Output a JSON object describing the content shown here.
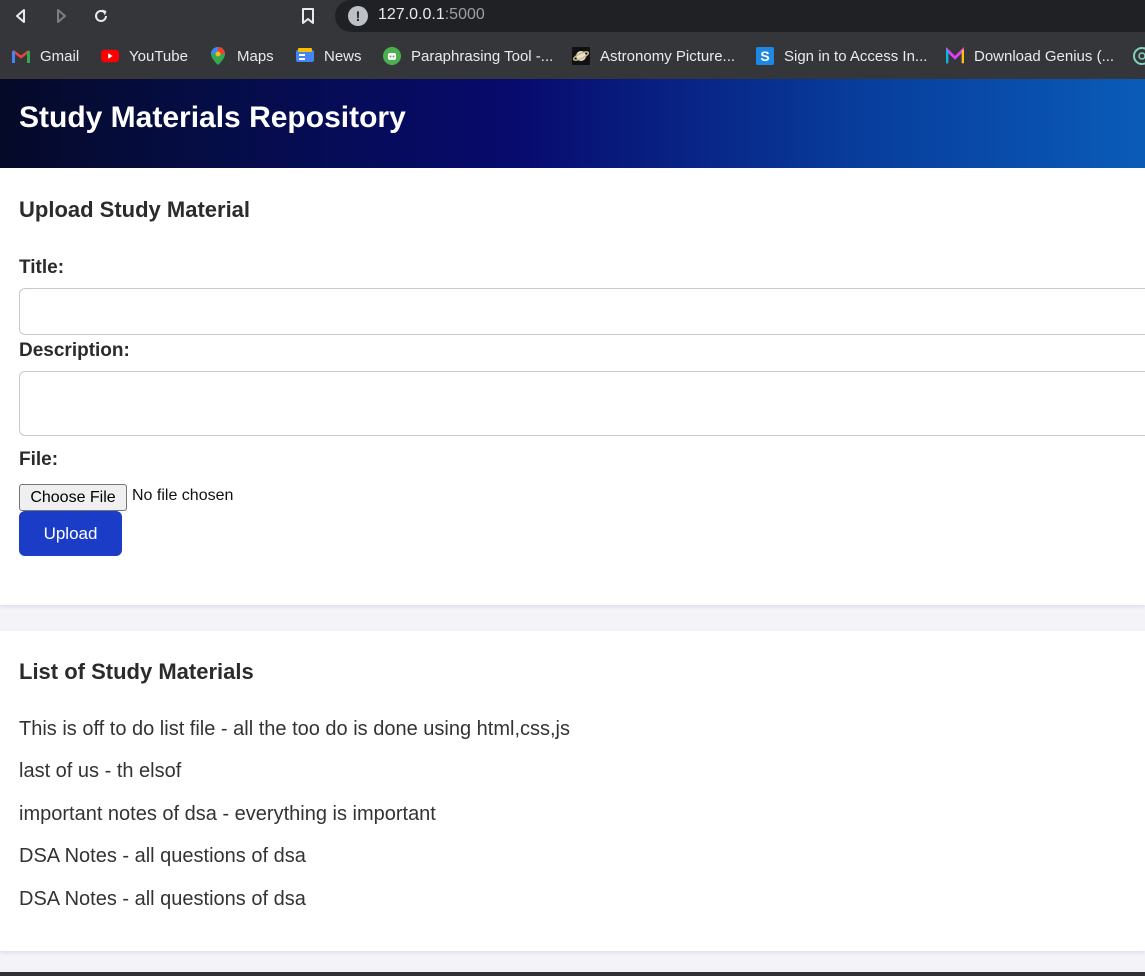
{
  "browser": {
    "url_host": "127.0.0.1",
    "url_port": ":5000",
    "bookmarks": [
      {
        "label": "Gmail",
        "icon": "gmail-icon"
      },
      {
        "label": "YouTube",
        "icon": "youtube-icon"
      },
      {
        "label": "Maps",
        "icon": "maps-icon"
      },
      {
        "label": "News",
        "icon": "news-icon"
      },
      {
        "label": "Paraphrasing Tool -...",
        "icon": "paraphrasing-tool-icon"
      },
      {
        "label": "Astronomy Picture...",
        "icon": "astronomy-picture-icon"
      },
      {
        "label": "Sign in to Access In...",
        "icon": "sign-in-icon"
      },
      {
        "label": "Download Genius (...",
        "icon": "download-genius-icon"
      }
    ]
  },
  "header": {
    "title": "Study Materials Repository"
  },
  "upload": {
    "heading": "Upload Study Material",
    "title_label": "Title:",
    "title_value": "",
    "description_label": "Description:",
    "description_value": "",
    "file_label": "File:",
    "choose_file_label": "Choose File",
    "no_file_text": "No file chosen",
    "upload_button": "Upload"
  },
  "list": {
    "heading": "List of Study Materials",
    "items": [
      "This is off to do list file - all the too do is done using html,css,js",
      "last of us - th elsof",
      "important notes of dsa - everything is important",
      "DSA Notes - all questions of dsa",
      "DSA Notes - all questions of dsa"
    ]
  },
  "colors": {
    "header_gradient_start": "#050a28",
    "header_gradient_end": "#0a5bb8",
    "upload_button": "#1a3cc6",
    "chrome_bg": "#35363a",
    "omnibox_bg": "#202124"
  }
}
